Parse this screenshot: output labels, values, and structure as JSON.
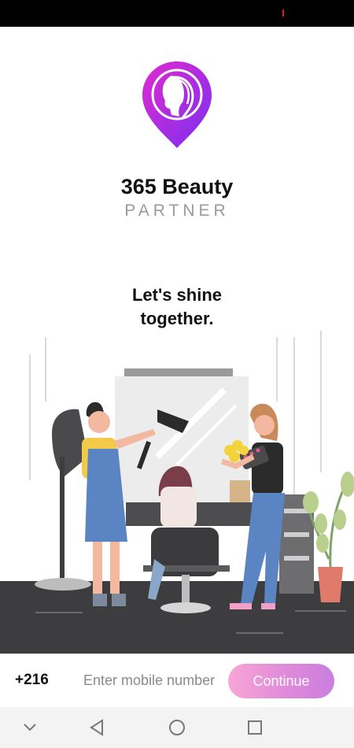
{
  "app": {
    "title": "365 Beauty",
    "subtitle": "PARTNER",
    "tagline_line1": "Let's shine",
    "tagline_line2": "together."
  },
  "login": {
    "country_code": "+216",
    "phone_placeholder": "Enter mobile number",
    "phone_value": "",
    "continue_label": "Continue"
  },
  "navigation": {
    "back_icon": "chevron-down-icon",
    "triangle_icon": "back-triangle-icon",
    "home_icon": "home-circle-icon",
    "recents_icon": "recents-square-icon"
  },
  "colors": {
    "brand_gradient_start": "#e02bd0",
    "brand_gradient_end": "#7a2ff0",
    "button_gradient_start": "#f7a6d6",
    "button_gradient_end": "#c97ee0",
    "status_bar": "#000000"
  }
}
